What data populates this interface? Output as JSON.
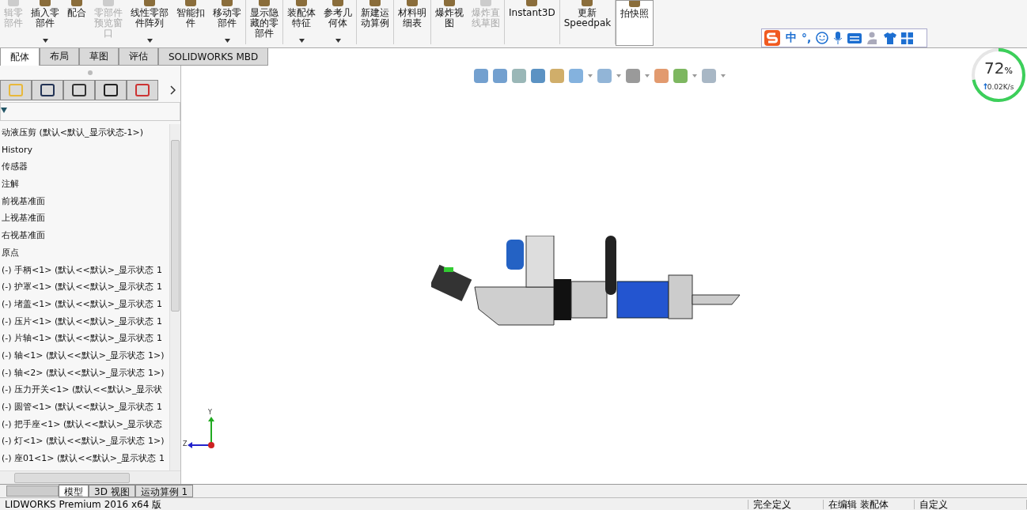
{
  "toolbar": [
    {
      "lines": [
        "辑零",
        "部件"
      ],
      "disabled": true,
      "caret": false
    },
    {
      "lines": [
        "插入零",
        "部件"
      ],
      "disabled": false,
      "caret": true
    },
    {
      "lines": [
        "配合"
      ],
      "disabled": false,
      "caret": false
    },
    {
      "lines": [
        "零部件",
        "预览窗",
        "口"
      ],
      "disabled": true,
      "caret": false
    },
    {
      "lines": [
        "线性零部",
        "件阵列"
      ],
      "disabled": false,
      "caret": true
    },
    {
      "lines": [
        "智能扣",
        "件"
      ],
      "disabled": false,
      "caret": false
    },
    {
      "lines": [
        "移动零",
        "部件"
      ],
      "disabled": false,
      "caret": true
    },
    {
      "lines": [
        "显示隐",
        "藏的零",
        "部件"
      ],
      "disabled": false,
      "caret": false
    },
    {
      "lines": [
        "装配体",
        "特征"
      ],
      "disabled": false,
      "caret": true
    },
    {
      "lines": [
        "参考几",
        "何体"
      ],
      "disabled": false,
      "caret": true
    },
    {
      "lines": [
        "新建运",
        "动算例"
      ],
      "disabled": false,
      "caret": false
    },
    {
      "lines": [
        "材料明",
        "细表"
      ],
      "disabled": false,
      "caret": false
    },
    {
      "lines": [
        "爆炸视",
        "图"
      ],
      "disabled": false,
      "caret": false
    },
    {
      "lines": [
        "爆炸直",
        "线草图"
      ],
      "disabled": true,
      "caret": false
    },
    {
      "lines": [
        "Instant3D"
      ],
      "disabled": false,
      "caret": false
    },
    {
      "lines": [
        "更新",
        "Speedpak"
      ],
      "disabled": false,
      "caret": false
    },
    {
      "lines": [
        "拍快照"
      ],
      "disabled": false,
      "caret": false
    }
  ],
  "tabs": [
    {
      "label": "配体",
      "selected": true
    },
    {
      "label": "布局",
      "selected": false
    },
    {
      "label": "草图",
      "selected": false
    },
    {
      "label": "评估",
      "selected": false
    },
    {
      "label": "SOLIDWORKS MBD",
      "selected": false
    }
  ],
  "ime": {
    "mode": "中",
    "punct": "°,"
  },
  "net_widget": {
    "percent": "72",
    "unit": "%",
    "speed": "0.02K/s",
    "level": 0.72
  },
  "tree": [
    "动液压剪  (默认<默认_显示状态-1>)",
    "History",
    "传感器",
    "注解",
    "前视基准面",
    "上视基准面",
    "右视基准面",
    "原点",
    "(-) 手柄<1> (默认<<默认>_显示状态 1",
    "(-) 护罩<1> (默认<<默认>_显示状态 1",
    "(-) 堵盖<1> (默认<<默认>_显示状态 1",
    "(-) 压片<1> (默认<<默认>_显示状态 1",
    "(-) 片轴<1> (默认<<默认>_显示状态 1",
    "(-) 轴<1> (默认<<默认>_显示状态 1>)",
    "(-) 轴<2> (默认<<默认>_显示状态 1>)",
    "(-) 压力开关<1> (默认<<默认>_显示状",
    "(-) 圆管<1> (默认<<默认>_显示状态 1",
    "(-) 把手座<1> (默认<<默认>_显示状态",
    "(-) 灯<1> (默认<<默认>_显示状态 1>)",
    "(-) 座01<1> (默认<<默认>_显示状态 1"
  ],
  "triad": {
    "y": "Y",
    "z": "Z"
  },
  "bottom_tabs": [
    {
      "label": "模型",
      "selected": true
    },
    {
      "label": "3D 视图",
      "selected": false
    },
    {
      "label": "运动算例 1",
      "selected": false
    }
  ],
  "status_bar": [
    "LIDWORKS Premium 2016 x64 版",
    "完全定义",
    "在编辑 装配体",
    "自定义"
  ]
}
